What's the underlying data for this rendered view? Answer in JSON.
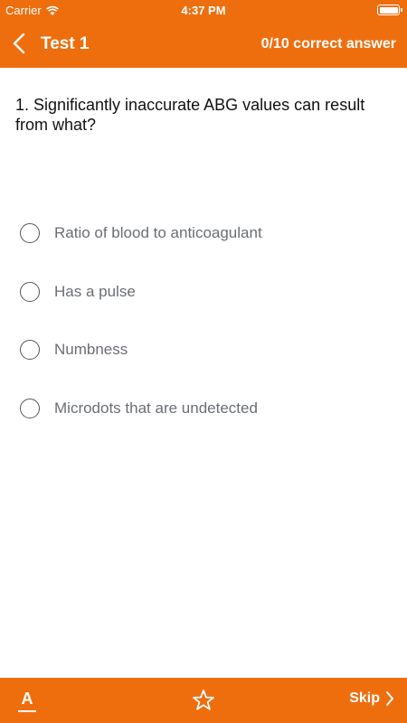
{
  "status_bar": {
    "carrier": "Carrier",
    "time": "4:37 PM"
  },
  "nav": {
    "title": "Test 1",
    "score": "0/10 correct answer"
  },
  "question": {
    "text": "1. Significantly inaccurate ABG values can result from what?"
  },
  "options": [
    {
      "label": "Ratio of blood to anticoagulant"
    },
    {
      "label": "Has a pulse"
    },
    {
      "label": "Numbness"
    },
    {
      "label": "Microdots that are undetected"
    }
  ],
  "toolbar": {
    "font_label": "A",
    "skip_label": "Skip"
  },
  "colors": {
    "brand": "#EE6E0E",
    "text_primary": "#111111",
    "option_text": "#6a6e74"
  }
}
